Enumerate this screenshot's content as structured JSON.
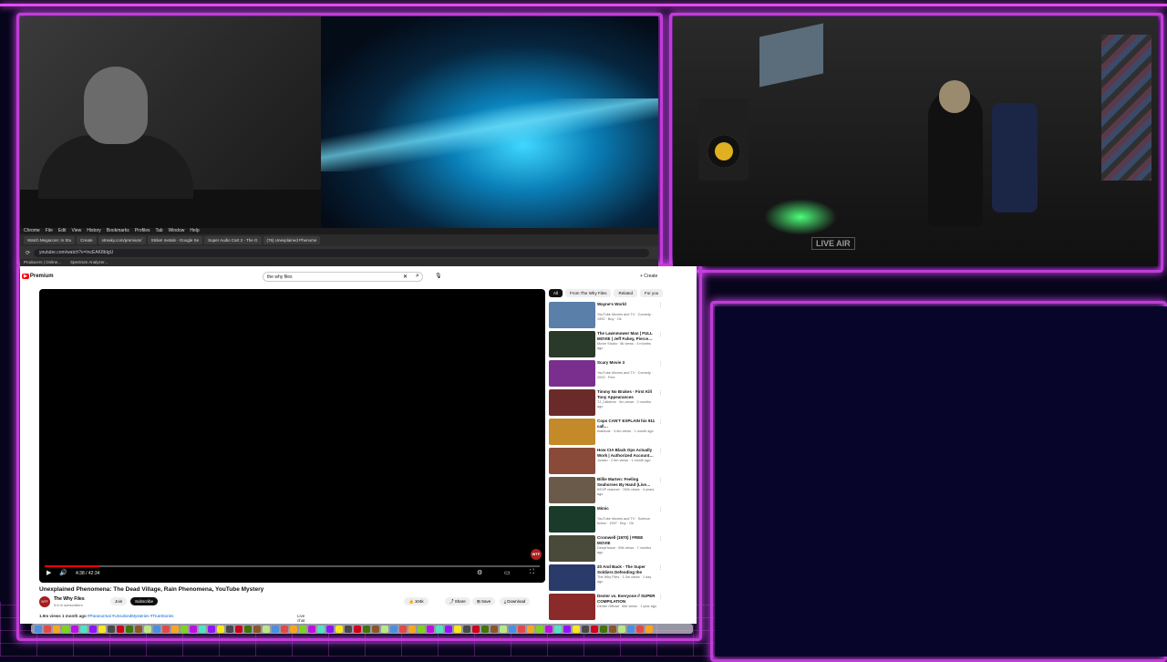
{
  "desktop": {
    "menubar": [
      "Chrome",
      "File",
      "Edit",
      "View",
      "History",
      "Bookmarks",
      "Profiles",
      "Tab",
      "Window",
      "Help"
    ],
    "tabs": [
      "Watch Megacore: In Stu",
      "Create",
      "streaky.com/premium/",
      "Strike! metals - Google Se",
      "Super Audio Cart 2 - The G",
      "(76) Unexplained Phenome"
    ],
    "url": "youtube.com/watch?v=IncEAK8bIgU",
    "bookmarks": [
      "Producers | Online...",
      "Spectrum Analyzer..."
    ]
  },
  "youtube": {
    "logo_badge": "▶",
    "logo_text": "Premium",
    "search_value": "the why files",
    "create_label": "+ Create",
    "player": {
      "time": "4:38 / 42:34",
      "progress": 0.11,
      "badge": "WTF"
    },
    "video_title": "Unexplained Phenomena: The Dead Village, Rain Phenomena, YouTube Mystery",
    "channel": {
      "avatar": "WTF",
      "name": "The Why Files",
      "subs": "5.6 m subscribers",
      "join": "Join",
      "subscribe": "Subscribe"
    },
    "actions": {
      "likes": "👍 104k",
      "share": "⤴ Share",
      "save": "⊞ Save",
      "download": "⤓ Download"
    },
    "description": {
      "stats": "1.9m views  1 month ago ",
      "tags": "#Paranormal #UnsolvedMysteries #TrueStories",
      "live": "Live chat replay"
    },
    "chips": [
      "All",
      "From The Why Files",
      "Related",
      "For you"
    ],
    "recommendations": [
      {
        "title": "Wayne's World",
        "meta": "YouTube Movies and TV · Comedy · 1992 · Buy · Ok",
        "thumb": "#5a7fa8"
      },
      {
        "title": "The Lawnmower Man | FULL MOVIE | Jeff Fahey, Pierce…",
        "meta": "Movie Studio · 8k views · 3 months ago",
        "thumb": "#2a3a2a"
      },
      {
        "title": "Scary Movie 3",
        "meta": "YouTube Movies and TV · Comedy · 2003 · Free",
        "thumb": "#7a2f8f"
      },
      {
        "title": "Timmy No Brakes - First Kill Tony Appearances",
        "meta": "TJ_Littletree · 5m views · 2 months ago",
        "thumb": "#6b2a2a"
      },
      {
        "title": "Cops CAN'T EXPLAIN his 911 call…",
        "meta": "Inabecar · 4.6m views · 1 month ago",
        "thumb": "#c48a2a"
      },
      {
        "title": "How CIA Black Ops Actually Work | Authorized Account…",
        "meta": "Jordan · 2.9m views · 1 month ago",
        "thumb": "#8a4a3a"
      },
      {
        "title": "Billie Marten: Feeling Seahorses By Hand (Live…",
        "meta": "KEXP channel · 762k views · 4 years ago",
        "thumb": "#6a5a4a"
      },
      {
        "title": "Mimic",
        "meta": "YouTube Movies and TV · Science fiction · 1997 · Buy · Ok",
        "thumb": "#1a3a2a"
      },
      {
        "title": "Cromwell (1970) | FREE MOVIE",
        "meta": "DeepHouse · 89k views · 7 months ago",
        "thumb": "#4a4a3a"
      },
      {
        "title": "20 And Back - The Super Soldiers Defending the Kuiper…",
        "meta": "The Why Files · 1.3m views · 1 day ago",
        "thumb": "#2a3a6a"
      },
      {
        "title": "Dexter vs. Everyone // SUPER COMPILATION",
        "meta": "Dexter Official · 66k views · 1 year ago",
        "thumb": "#8a2a2a"
      }
    ]
  },
  "dock_colors": [
    "#4a90e2",
    "#e24a4a",
    "#f5a623",
    "#7ed321",
    "#bd10e0",
    "#50e3c2",
    "#9013fe",
    "#f8e71c",
    "#4a4a4a",
    "#d0021b",
    "#417505",
    "#8b572a",
    "#b8e986",
    "#4a90e2",
    "#e24a4a",
    "#f5a623",
    "#7ed321",
    "#bd10e0",
    "#50e3c2",
    "#9013fe",
    "#f8e71c",
    "#4a4a4a",
    "#d0021b",
    "#417505",
    "#8b572a",
    "#b8e986",
    "#4a90e2",
    "#e24a4a",
    "#f5a623",
    "#7ed321",
    "#bd10e0",
    "#50e3c2",
    "#9013fe",
    "#f8e71c",
    "#4a4a4a",
    "#d0021b",
    "#417505",
    "#8b572a",
    "#b8e986",
    "#4a90e2",
    "#e24a4a",
    "#f5a623",
    "#7ed321",
    "#bd10e0",
    "#50e3c2",
    "#9013fe",
    "#f8e71c",
    "#4a4a4a",
    "#d0021b",
    "#417505",
    "#8b572a",
    "#b8e986",
    "#4a90e2",
    "#e24a4a",
    "#f5a623",
    "#7ed321",
    "#bd10e0",
    "#50e3c2",
    "#9013fe",
    "#f8e71c",
    "#4a4a4a",
    "#d0021b",
    "#417505",
    "#8b572a",
    "#b8e986",
    "#4a90e2",
    "#e24a4a",
    "#f5a623"
  ],
  "cam2": {
    "sign": "LIVE AIR"
  },
  "accent": "#e34dff"
}
